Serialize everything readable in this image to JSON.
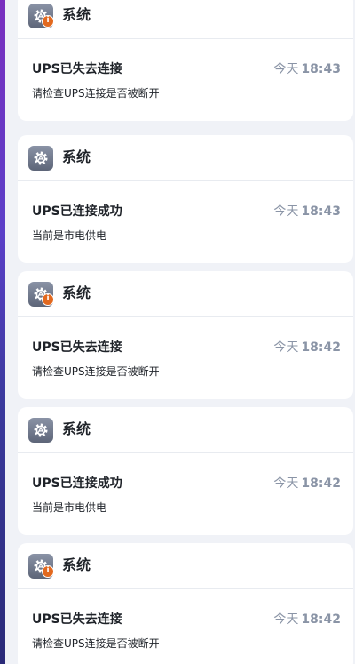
{
  "notifications": [
    {
      "app": "系统",
      "icon": "gear-icon",
      "badge": "i",
      "title": "UPS已失去连接",
      "day": "今天",
      "time": "18:43",
      "message": "请检查UPS连接是否被断开"
    },
    {
      "app": "系统",
      "icon": "gear-icon",
      "badge": "",
      "title": "UPS已连接成功",
      "day": "今天",
      "time": "18:43",
      "message": "当前是市电供电"
    },
    {
      "app": "系统",
      "icon": "gear-icon",
      "badge": "i",
      "title": "UPS已失去连接",
      "day": "今天",
      "time": "18:42",
      "message": "请检查UPS连接是否被断开"
    },
    {
      "app": "系统",
      "icon": "gear-icon",
      "badge": "",
      "title": "UPS已连接成功",
      "day": "今天",
      "time": "18:42",
      "message": "当前是市电供电"
    },
    {
      "app": "系统",
      "icon": "gear-icon",
      "badge": "i",
      "title": "UPS已失去连接",
      "day": "今天",
      "time": "18:42",
      "message": "请检查UPS连接是否被断开"
    }
  ],
  "colors": {
    "badge": "#e2691f",
    "time": "#8a94a6",
    "text": "#1f2329",
    "card": "#ffffff",
    "background": "#f0f2f7"
  }
}
